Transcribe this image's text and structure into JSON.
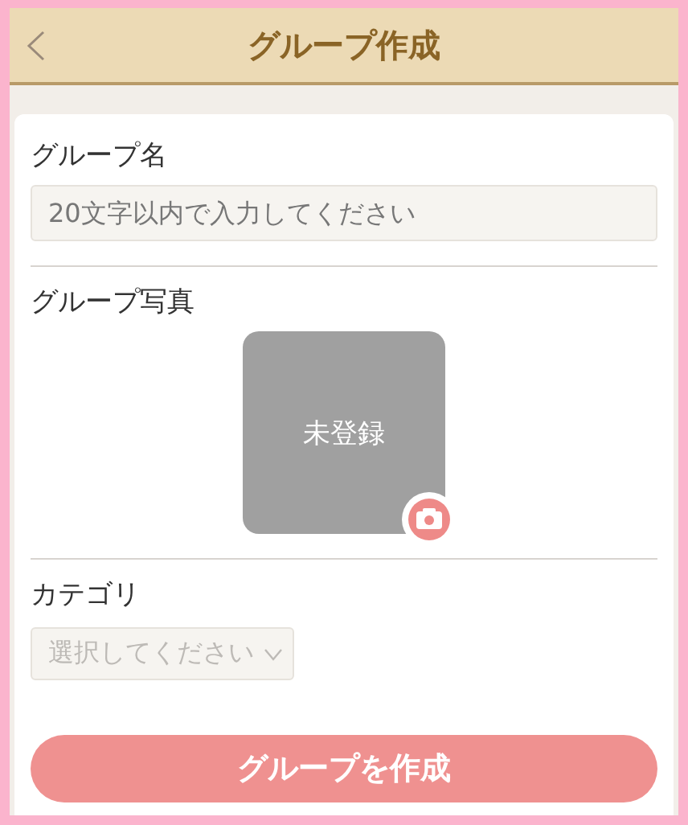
{
  "header": {
    "title": "グループ作成"
  },
  "fields": [
    {
      "kind": "text",
      "label": "グループ名",
      "placeholder": "20文字以内で入力してください"
    },
    {
      "kind": "photo",
      "label": "グループ写真",
      "status": "未登録"
    },
    {
      "kind": "select",
      "label": "カテゴリ",
      "placeholder": "選択してください"
    }
  ],
  "submit": "グループを作成"
}
